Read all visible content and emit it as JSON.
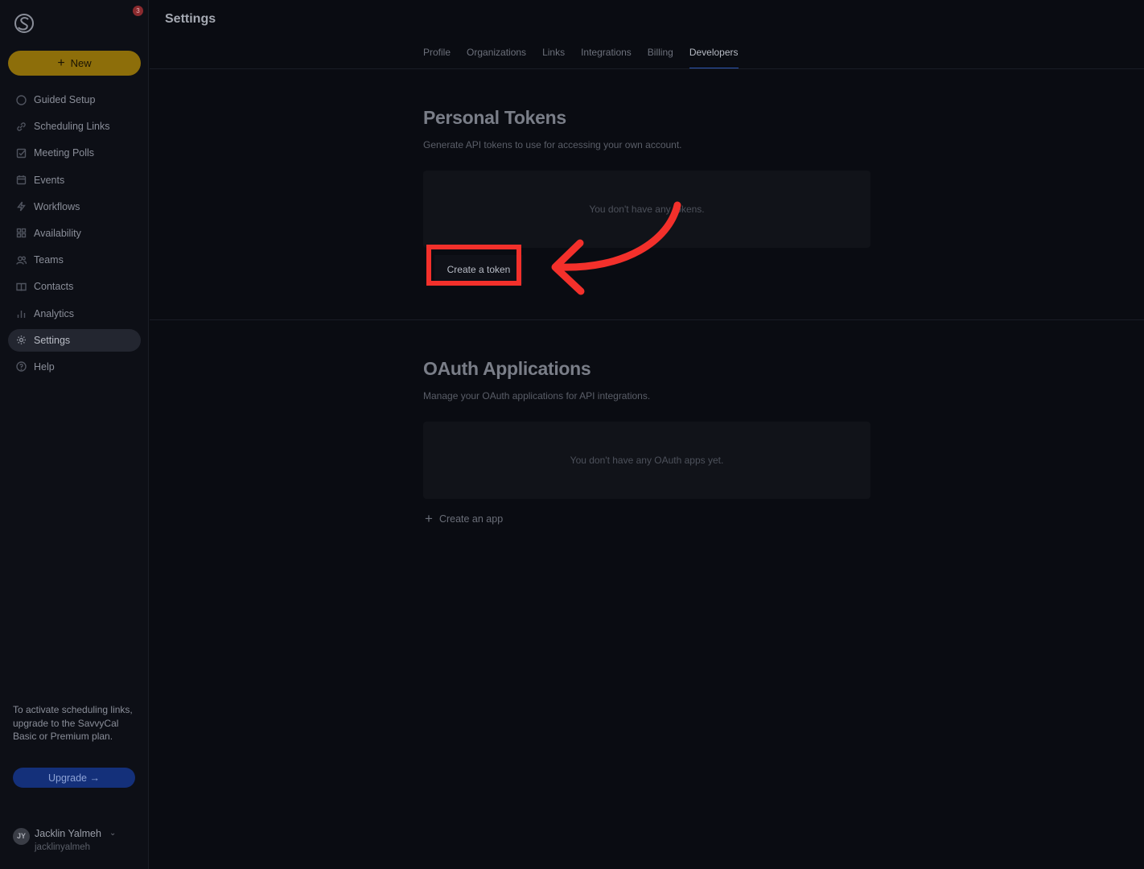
{
  "app": {
    "notification_count": "3"
  },
  "sidebar": {
    "new_label": "New",
    "items": [
      {
        "label": "Guided Setup",
        "icon": "circle-icon"
      },
      {
        "label": "Scheduling Links",
        "icon": "link-icon"
      },
      {
        "label": "Meeting Polls",
        "icon": "checkbox-icon"
      },
      {
        "label": "Events",
        "icon": "calendar-icon"
      },
      {
        "label": "Workflows",
        "icon": "bolt-icon"
      },
      {
        "label": "Availability",
        "icon": "grid-icon"
      },
      {
        "label": "Teams",
        "icon": "users-icon"
      },
      {
        "label": "Contacts",
        "icon": "book-icon"
      },
      {
        "label": "Analytics",
        "icon": "bar-chart-icon"
      },
      {
        "label": "Settings",
        "icon": "gear-icon",
        "active": true
      },
      {
        "label": "Help",
        "icon": "help-icon"
      }
    ],
    "upgrade_text": "To activate scheduling links, upgrade to the SavvyCal Basic or Premium plan.",
    "upgrade_button": "Upgrade →",
    "user": {
      "initials": "JY",
      "name": "Jacklin Yalmeh",
      "handle": "jacklinyalmeh"
    }
  },
  "header": {
    "title": "Settings",
    "tabs": [
      "Profile",
      "Organizations",
      "Links",
      "Integrations",
      "Billing",
      "Developers"
    ],
    "active_tab": "Developers"
  },
  "personal_tokens": {
    "title": "Personal Tokens",
    "description": "Generate API tokens to use for accessing your own account.",
    "empty_text": "You don't have any tokens.",
    "create_button": "Create a token"
  },
  "oauth": {
    "title": "OAuth Applications",
    "description": "Manage your OAuth applications for API integrations.",
    "empty_text": "You don't have any OAuth apps yet.",
    "create_button": "Create an app"
  },
  "colors": {
    "accent_new": "#8d6e0a",
    "upgrade": "#14307a",
    "annotation": "#f3302b",
    "active_tab_underline": "#2a55b0"
  }
}
